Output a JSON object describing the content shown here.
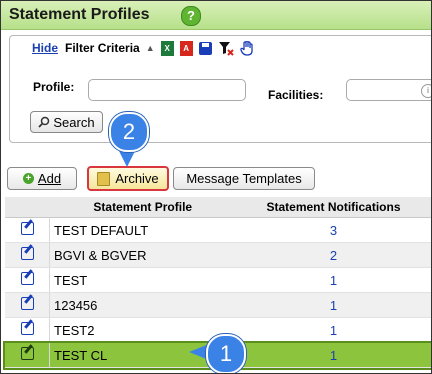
{
  "header": {
    "title": "Statement Profiles",
    "help_icon": "?"
  },
  "filter": {
    "hide_link": "Hide",
    "label": "Filter Criteria",
    "icons": [
      "collapse-arrow-icon",
      "excel-icon",
      "pdf-icon",
      "save-icon",
      "clear-filter-icon",
      "pin-hand-icon"
    ],
    "profile_label": "Profile:",
    "profile_value": "",
    "facilities_label": "Facilities:",
    "facilities_value": "",
    "search_button": "Search"
  },
  "toolbar": {
    "add_label": "Add",
    "archive_label": "Archive",
    "message_templates_label": "Message Templates"
  },
  "table": {
    "columns": [
      "",
      "Statement Profile",
      "Statement Notifications"
    ],
    "rows": [
      {
        "name": "TEST DEFAULT",
        "notifications": "3"
      },
      {
        "name": "BGVI & BGVER",
        "notifications": "2"
      },
      {
        "name": "TEST",
        "notifications": "1"
      },
      {
        "name": "123456",
        "notifications": "1"
      },
      {
        "name": "TEST2",
        "notifications": "1"
      },
      {
        "name": "TEST CL",
        "notifications": "1"
      }
    ],
    "selected_row": 5
  },
  "callouts": {
    "one": "1",
    "two": "2"
  },
  "colors": {
    "header_green": "#b6e08a",
    "selected_row": "#8cc43e",
    "callout_blue": "#3b82e6",
    "archive_border": "#d9363e"
  }
}
